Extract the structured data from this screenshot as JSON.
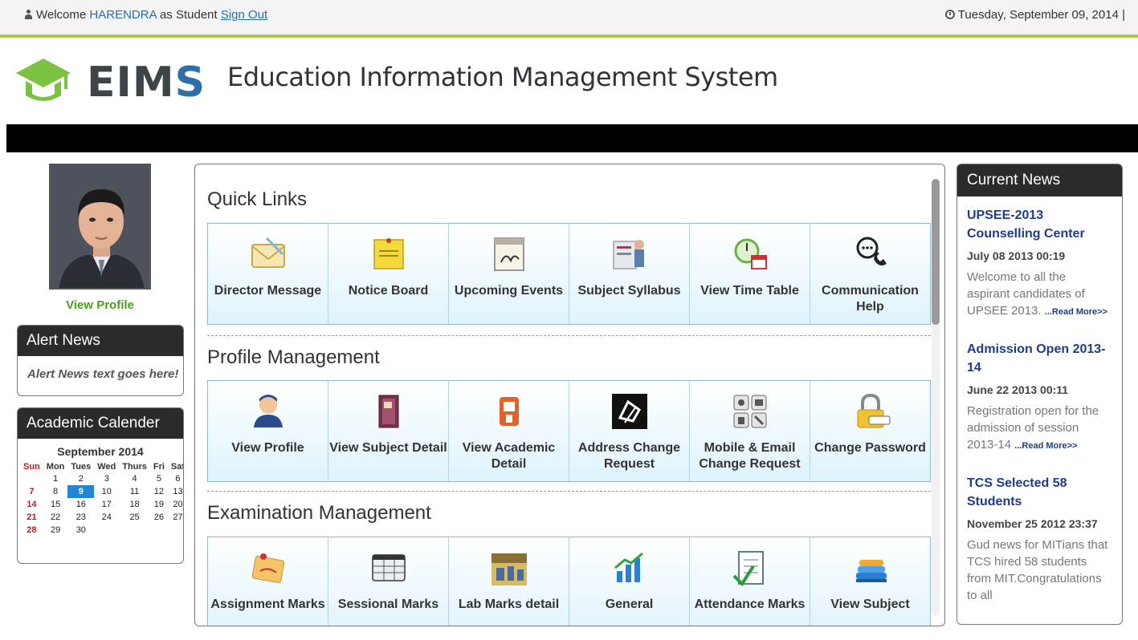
{
  "topbar": {
    "welcome_prefix": "Welcome",
    "user_name": "HARENDRA",
    "role_text": "as Student",
    "sign_out": "Sign Out",
    "date": "Tuesday, September 09, 2014 |"
  },
  "header": {
    "logo_text_main": "EIM",
    "logo_text_s": "S",
    "title": "Education Information Management System"
  },
  "sidebar": {
    "view_profile": "View Profile",
    "alert_news": {
      "title": "Alert News",
      "text": "Alert News text goes here!"
    },
    "calendar": {
      "title": "Academic Calender",
      "month": "September 2014",
      "days": [
        "Sun",
        "Mon",
        "Tues",
        "Wed",
        "Thurs",
        "Fri",
        "Sat"
      ],
      "weeks": [
        [
          "",
          "1",
          "2",
          "3",
          "4",
          "5",
          "6"
        ],
        [
          "7",
          "8",
          "9",
          "10",
          "11",
          "12",
          "13"
        ],
        [
          "14",
          "15",
          "16",
          "17",
          "18",
          "19",
          "20"
        ],
        [
          "21",
          "22",
          "23",
          "24",
          "25",
          "26",
          "27"
        ],
        [
          "28",
          "29",
          "30",
          "",
          "",
          "",
          ""
        ]
      ],
      "today": "9"
    }
  },
  "main": {
    "sections": [
      {
        "title": "Quick Links",
        "tiles": [
          {
            "label": "Director Message",
            "icon": "envelope-icon"
          },
          {
            "label": "Notice Board",
            "icon": "notice-board-icon"
          },
          {
            "label": "Upcoming Events",
            "icon": "events-icon"
          },
          {
            "label": "Subject Syllabus",
            "icon": "syllabus-icon"
          },
          {
            "label": "View Time Table",
            "icon": "clock-calendar-icon"
          },
          {
            "label": "Communication Help",
            "icon": "phone-chat-icon"
          }
        ]
      },
      {
        "title": "Profile Management",
        "tiles": [
          {
            "label": "View Profile",
            "icon": "user-icon"
          },
          {
            "label": "View Subject Detail",
            "icon": "book-icon"
          },
          {
            "label": "View Academic Detail",
            "icon": "academic-icon"
          },
          {
            "label": "Address Change Request",
            "icon": "address-icon"
          },
          {
            "label": "Mobile & Email Change Request",
            "icon": "contact-icon"
          },
          {
            "label": "Change Password",
            "icon": "lock-icon"
          }
        ]
      },
      {
        "title": "Examination Management",
        "tiles": [
          {
            "label": "Assignment Marks",
            "icon": "assignment-icon"
          },
          {
            "label": "Sessional Marks",
            "icon": "sessional-icon"
          },
          {
            "label": "Lab Marks detail",
            "icon": "lab-icon"
          },
          {
            "label": "General",
            "icon": "bar-chart-icon"
          },
          {
            "label": "Attendance Marks",
            "icon": "attendance-icon"
          },
          {
            "label": "View Subject",
            "icon": "books-stack-icon"
          }
        ]
      }
    ]
  },
  "news": {
    "title": "Current News",
    "items": [
      {
        "title": "UPSEE-2013 Counselling Center",
        "date": "July 08 2013 00:19",
        "text": "Welcome to all the aspirant candidates of UPSEE 2013.",
        "read_more": "...Read More>>"
      },
      {
        "title": "Admission Open 2013-14",
        "date": "June 22 2013 00:11",
        "text": "Registration open for the admission of session 2013-14",
        "read_more": "...Read More>>"
      },
      {
        "title": "TCS Selected 58 Students",
        "date": "November 25 2012 23:37",
        "text": "Gud news for MITians that TCS hired 58 students from MIT.Congratulations to all",
        "read_more": ""
      }
    ]
  },
  "colors": {
    "accent_green": "#a8cc44",
    "link_blue": "#1f6fb8",
    "profile_green": "#4aa01a",
    "news_title": "#1f3c8a"
  }
}
